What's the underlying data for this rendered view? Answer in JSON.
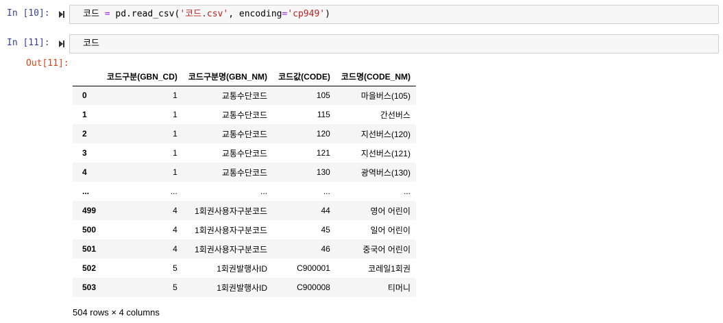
{
  "cell10": {
    "prompt": "In [10]:",
    "code": {
      "var": "코드 ",
      "op": "=",
      "call": " pd.read_csv(",
      "str1": "'코드.csv'",
      "mid": ", encoding",
      "eq": "=",
      "str2": "'cp949'",
      "end": ")"
    }
  },
  "cell11": {
    "prompt": "In [11]:",
    "code": "코드",
    "out_prompt": "Out[11]:"
  },
  "dataframe": {
    "columns": [
      "",
      "코드구분(GBN_CD)",
      "코드구분명(GBN_NM)",
      "코드값(CODE)",
      "코드명(CODE_NM)"
    ],
    "rows": [
      [
        "0",
        "1",
        "교통수단코드",
        "105",
        "마을버스(105)"
      ],
      [
        "1",
        "1",
        "교통수단코드",
        "115",
        "간선버스"
      ],
      [
        "2",
        "1",
        "교통수단코드",
        "120",
        "지선버스(120)"
      ],
      [
        "3",
        "1",
        "교통수단코드",
        "121",
        "지선버스(121)"
      ],
      [
        "4",
        "1",
        "교통수단코드",
        "130",
        "광역버스(130)"
      ],
      [
        "...",
        "...",
        "...",
        "...",
        "..."
      ],
      [
        "499",
        "4",
        "1회권사용자구분코드",
        "44",
        "영어 어린이"
      ],
      [
        "500",
        "4",
        "1회권사용자구분코드",
        "45",
        "일어 어린이"
      ],
      [
        "501",
        "4",
        "1회권사용자구분코드",
        "46",
        "중국어 어린이"
      ],
      [
        "502",
        "5",
        "1회권발행사ID",
        "C900001",
        "코레일1회권"
      ],
      [
        "503",
        "5",
        "1회권발행사ID",
        "C900008",
        "티머니"
      ]
    ],
    "summary": "504 rows × 4 columns"
  }
}
